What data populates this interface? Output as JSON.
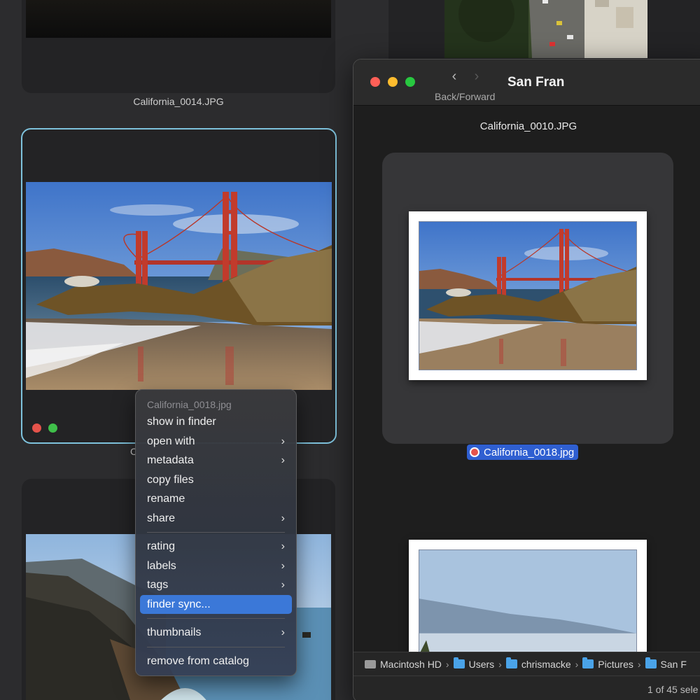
{
  "grid": {
    "top_caption": "California_0014.JPG",
    "selected_caption_fragment": "C",
    "label_colors": [
      "#e5534b",
      "#3fbf4a"
    ]
  },
  "finder": {
    "title": "San Fran",
    "nav_caption": "Back/Forward",
    "preview_filename": "California_0010.JPG",
    "selected_filename": "California_0018.jpg",
    "path": [
      {
        "label": "Macintosh HD",
        "icon": "hard-drive-icon"
      },
      {
        "label": "Users",
        "icon": "folder-icon"
      },
      {
        "label": "chrismacke",
        "icon": "home-folder-icon"
      },
      {
        "label": "Pictures",
        "icon": "folder-icon"
      },
      {
        "label": "San F",
        "icon": "folder-icon"
      }
    ],
    "status": "1 of 45 sele",
    "traffic_colors": [
      "#ff5f57",
      "#febc2e",
      "#28c840"
    ]
  },
  "context_menu": {
    "header": "California_0018.jpg",
    "items": [
      {
        "label": "show in finder",
        "submenu": false
      },
      {
        "label": "open with",
        "submenu": true
      },
      {
        "label": "metadata",
        "submenu": true
      },
      {
        "label": "copy files",
        "submenu": false
      },
      {
        "label": "rename",
        "submenu": false
      },
      {
        "label": "share",
        "submenu": true
      },
      {
        "label": "rating",
        "submenu": true
      },
      {
        "label": "labels",
        "submenu": true
      },
      {
        "label": "tags",
        "submenu": true
      },
      {
        "label": "finder sync...",
        "submenu": false,
        "highlighted": true
      },
      {
        "label": "thumbnails",
        "submenu": true
      },
      {
        "label": "remove from catalog",
        "submenu": false
      }
    ],
    "accent": "#3b78d8"
  }
}
